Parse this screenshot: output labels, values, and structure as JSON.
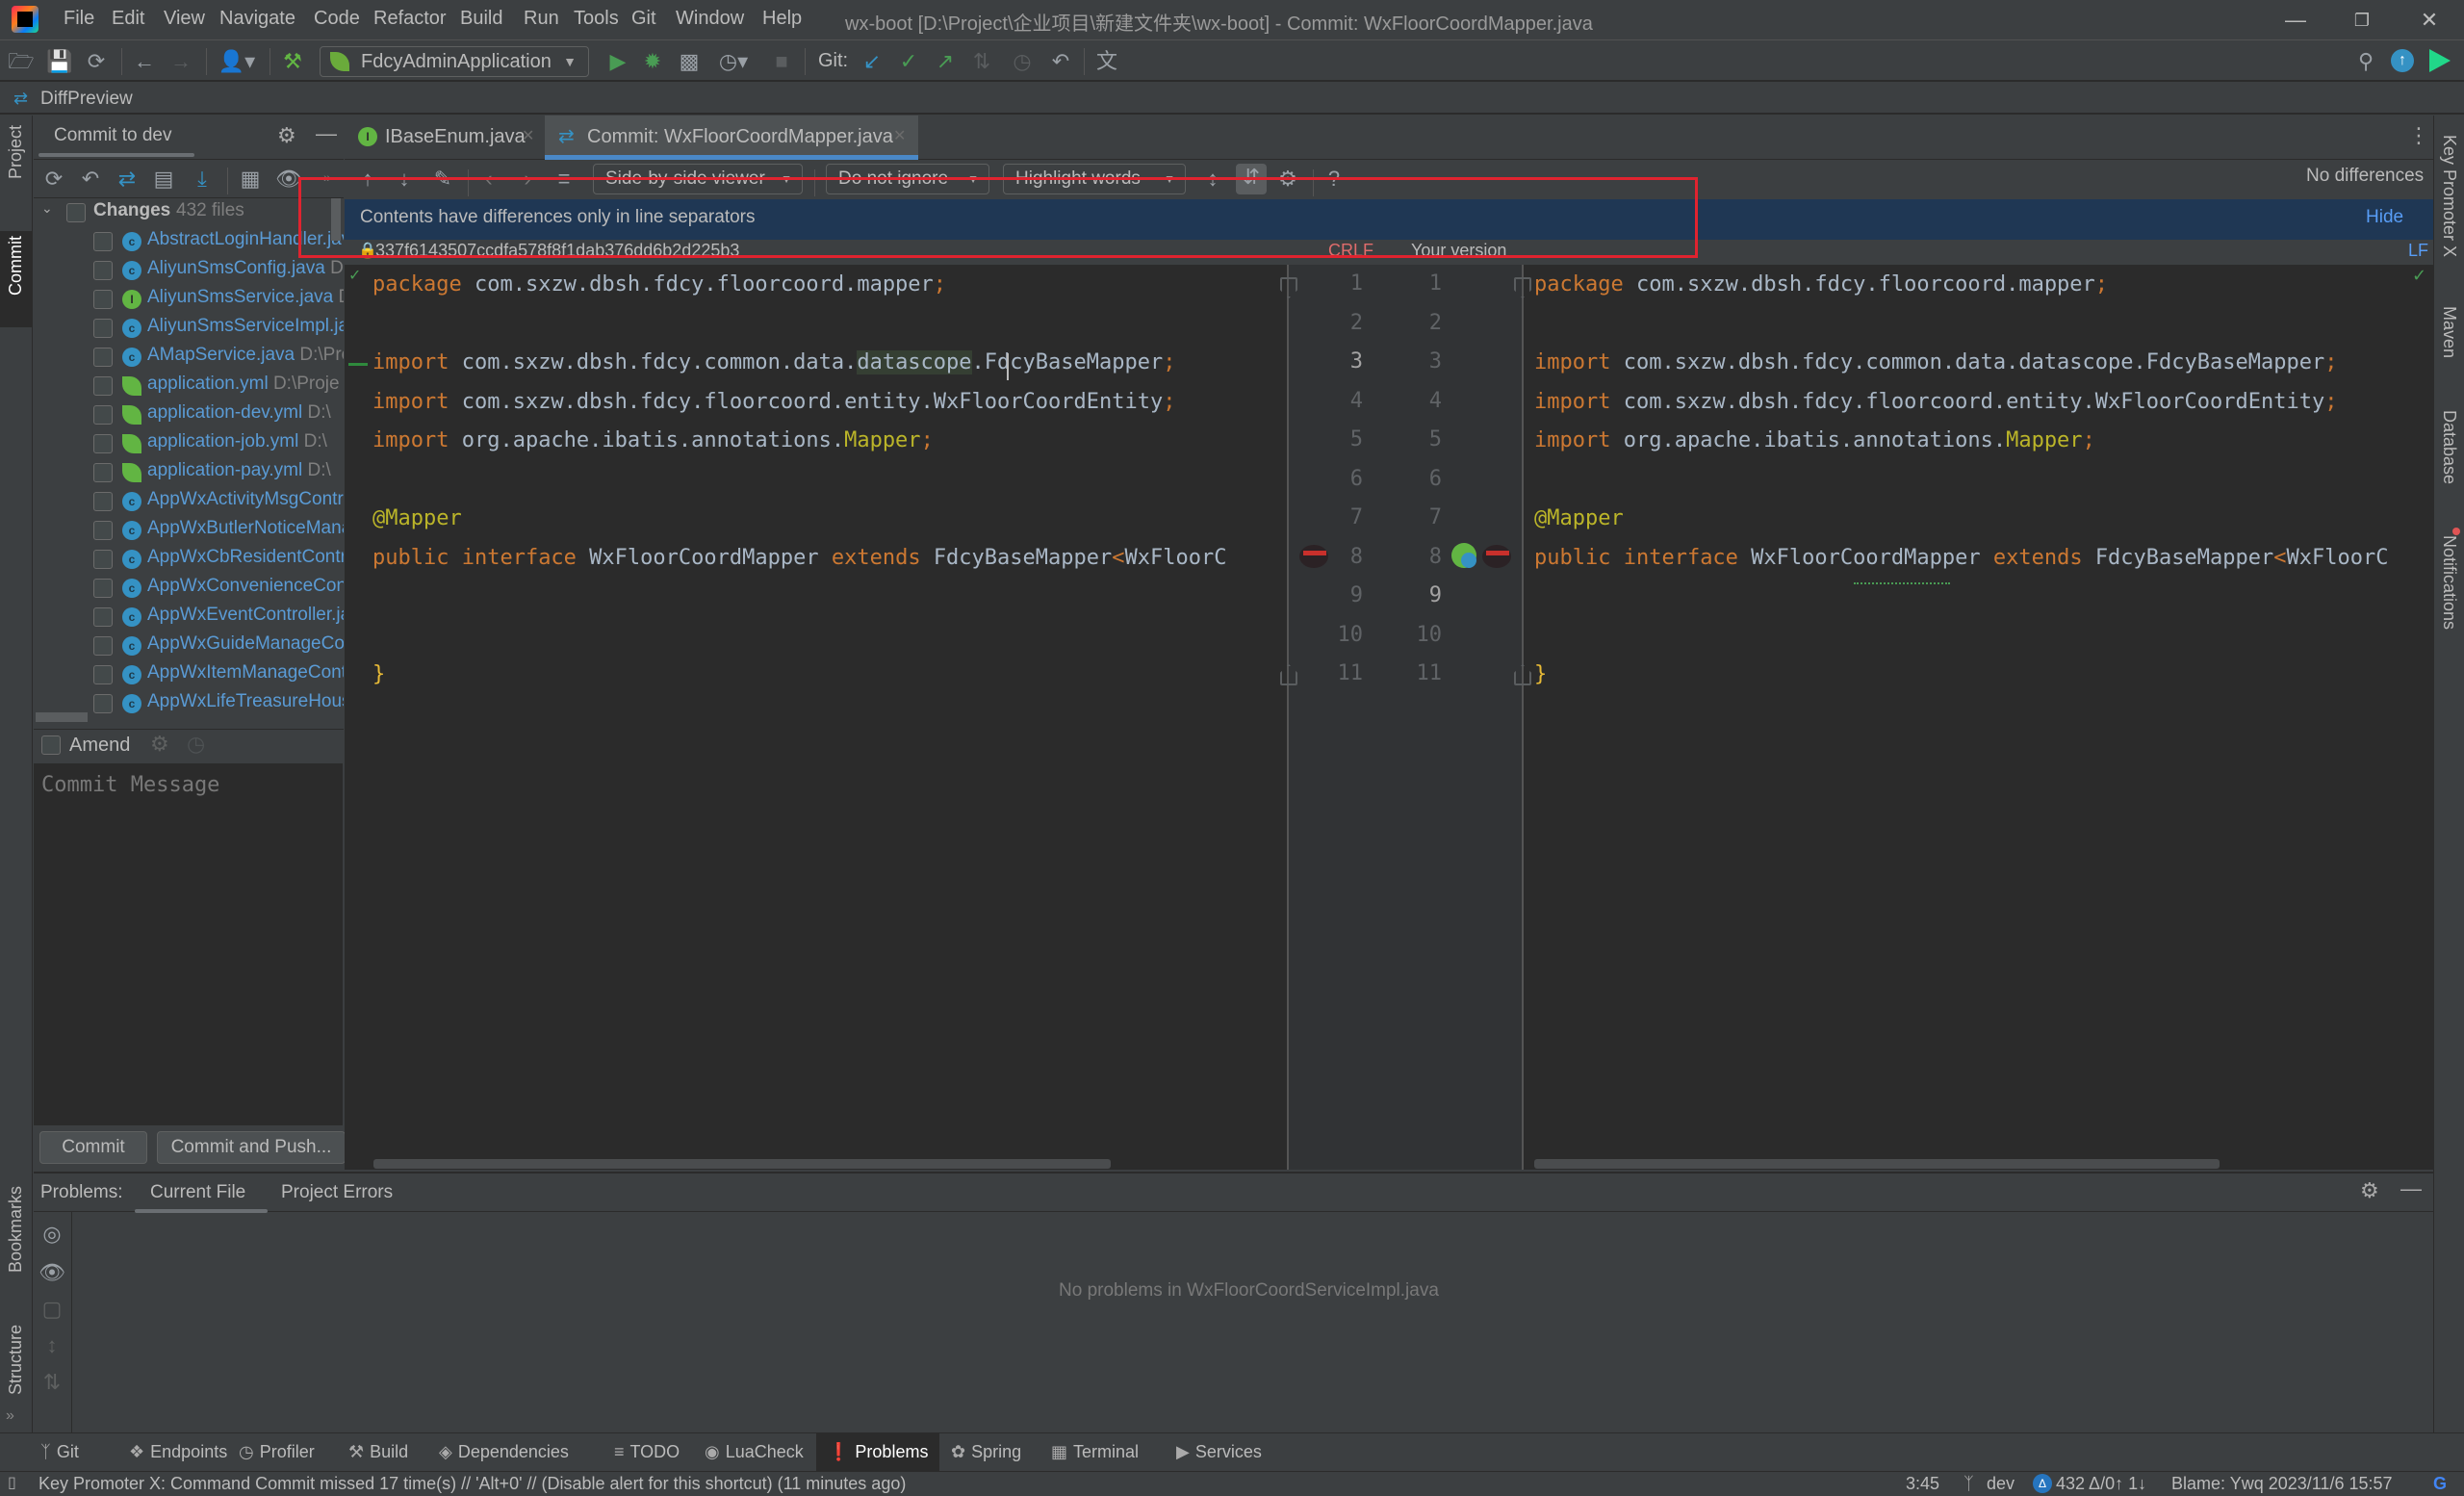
{
  "window": {
    "title": "wx-boot [D:\\Project\\企业项目\\新建文件夹\\wx-boot] - Commit: WxFloorCoordMapper.java",
    "controls": [
      "minimize",
      "restore",
      "close"
    ]
  },
  "menu": [
    "File",
    "Edit",
    "View",
    "Navigate",
    "Code",
    "Refactor",
    "Build",
    "Run",
    "Tools",
    "Git",
    "Window",
    "Help"
  ],
  "toolbar": {
    "run_config": "FdcyAdminApplication",
    "git_label": "Git:"
  },
  "diffpreview": {
    "label": "DiffPreview"
  },
  "left_stripe": {
    "project": "Project",
    "commit": "Commit",
    "bookmarks": "Bookmarks",
    "structure": "Structure"
  },
  "right_stripe": {
    "key_promoter": "Key Promoter X",
    "maven": "Maven",
    "database": "Database",
    "notifications": "Notifications"
  },
  "commit_panel": {
    "tab_label": "Commit to dev",
    "changes_label": "Changes",
    "changes_count": "432 files",
    "files": [
      {
        "name": "AbstractLoginHandler.java",
        "path": "",
        "type": "c-abstract"
      },
      {
        "name": "AliyunSmsConfig.java",
        "path": "D",
        "type": "c"
      },
      {
        "name": "AliyunSmsService.java",
        "path": "D",
        "type": "i"
      },
      {
        "name": "AliyunSmsServiceImpl.java",
        "path": "",
        "type": "c"
      },
      {
        "name": "AMapService.java",
        "path": "D:\\Pro",
        "type": "c"
      },
      {
        "name": "application.yml",
        "path": "D:\\Proje",
        "type": "yml"
      },
      {
        "name": "application-dev.yml",
        "path": "D:\\",
        "type": "yml"
      },
      {
        "name": "application-job.yml",
        "path": "D:\\",
        "type": "yml"
      },
      {
        "name": "application-pay.yml",
        "path": "D:\\",
        "type": "yml"
      },
      {
        "name": "AppWxActivityMsgController.java",
        "path": "",
        "type": "c"
      },
      {
        "name": "AppWxButlerNoticeManageController.java",
        "path": "",
        "type": "c"
      },
      {
        "name": "AppWxCbResidentController.java",
        "path": "",
        "type": "c"
      },
      {
        "name": "AppWxConvenienceController.java",
        "path": "",
        "type": "c"
      },
      {
        "name": "AppWxEventController.java",
        "path": "",
        "type": "c"
      },
      {
        "name": "AppWxGuideManageController.java",
        "path": "",
        "type": "c"
      },
      {
        "name": "AppWxItemManageController.java",
        "path": "",
        "type": "c"
      },
      {
        "name": "AppWxLifeTreasureHouseController.java",
        "path": "",
        "type": "c"
      }
    ],
    "amend_label": "Amend",
    "commit_message_placeholder": "Commit Message",
    "commit_message_value": "",
    "commit_button": "Commit",
    "commit_push_button": "Commit and Push..."
  },
  "editor_tabs": [
    {
      "label": "IBaseEnum.java",
      "icon": "interface-icon",
      "active": false
    },
    {
      "label": "Commit: WxFloorCoordMapper.java",
      "icon": "diff-icon",
      "active": true
    }
  ],
  "diff_toolbar": {
    "viewer": "Side-by-side viewer",
    "ignore": "Do not ignore",
    "highlight": "Highlight words",
    "status": "No differences"
  },
  "banner": {
    "message": "Contents have differences only in line separators",
    "hide": "Hide"
  },
  "diff_header": {
    "left_hash": "337f6143507ccdfa578f8f1dab376dd6b2d225b3",
    "left_separator": "CRLF",
    "right_title": "Your version",
    "right_separator": "LF"
  },
  "code": {
    "left_lines": [
      [
        {
          "t": "package ",
          "c": "kw"
        },
        {
          "t": "com.sxzw.dbsh.fdcy.floorcoord.mapper",
          "c": ""
        },
        {
          "t": ";",
          "c": "sym"
        }
      ],
      [],
      [
        {
          "t": "import ",
          "c": "kw"
        },
        {
          "t": "com.sxzw.dbsh.fdcy.common.data.",
          "c": ""
        },
        {
          "t": "datascope",
          "c": "hlword"
        },
        {
          "t": ".FdcyBaseMapper",
          "c": ""
        },
        {
          "t": ";",
          "c": "sym"
        }
      ],
      [
        {
          "t": "import ",
          "c": "kw"
        },
        {
          "t": "com.sxzw.dbsh.fdcy.floorcoord.entity.WxFloorCoordEntity",
          "c": ""
        },
        {
          "t": ";",
          "c": "sym"
        }
      ],
      [
        {
          "t": "import ",
          "c": "kw"
        },
        {
          "t": "org.apache.ibatis.annotations.",
          "c": ""
        },
        {
          "t": "Mapper",
          "c": "ann"
        },
        {
          "t": ";",
          "c": "sym"
        }
      ],
      [],
      [
        {
          "t": "@Mapper",
          "c": "ann"
        }
      ],
      [
        {
          "t": "public ",
          "c": "kw"
        },
        {
          "t": "interface ",
          "c": "kw"
        },
        {
          "t": "WxFloorCoordMapper ",
          "c": ""
        },
        {
          "t": "extends ",
          "c": "kw"
        },
        {
          "t": "FdcyBaseMapper",
          "c": ""
        },
        {
          "t": "<",
          "c": "sym"
        },
        {
          "t": "WxFloorC",
          "c": ""
        }
      ],
      [],
      [],
      [
        {
          "t": "}",
          "c": "brace"
        }
      ]
    ],
    "right_lines": [
      [
        {
          "t": "package ",
          "c": "kw"
        },
        {
          "t": "com.sxzw.dbsh.fdcy.floorcoord.mapper",
          "c": ""
        },
        {
          "t": ";",
          "c": "sym"
        }
      ],
      [],
      [
        {
          "t": "import ",
          "c": "kw"
        },
        {
          "t": "com.sxzw.dbsh.fdcy.common.data.datascope.FdcyBaseMapper",
          "c": ""
        },
        {
          "t": ";",
          "c": "sym"
        }
      ],
      [
        {
          "t": "import ",
          "c": "kw"
        },
        {
          "t": "com.sxzw.dbsh.fdcy.floorcoord.entity.WxFloorCoordEntity",
          "c": ""
        },
        {
          "t": ";",
          "c": "sym"
        }
      ],
      [
        {
          "t": "import ",
          "c": "kw"
        },
        {
          "t": "org.apache.ibatis.annotations.",
          "c": ""
        },
        {
          "t": "Mapper",
          "c": "ann"
        },
        {
          "t": ";",
          "c": "sym"
        }
      ],
      [],
      [
        {
          "t": "@Mapper",
          "c": "ann"
        }
      ],
      [
        {
          "t": "public ",
          "c": "kw"
        },
        {
          "t": "interface ",
          "c": "kw"
        },
        {
          "t": "WxFloorCoordMapper ",
          "c": ""
        },
        {
          "t": "extends ",
          "c": "kw"
        },
        {
          "t": "FdcyBaseMapper",
          "c": ""
        },
        {
          "t": "<",
          "c": "sym"
        },
        {
          "t": "WxFloorC",
          "c": ""
        }
      ],
      [],
      [],
      [
        {
          "t": "}",
          "c": "brace"
        }
      ]
    ],
    "line_numbers": [
      "1",
      "2",
      "3",
      "4",
      "5",
      "6",
      "7",
      "8",
      "9",
      "10",
      "11"
    ],
    "left_current_line": "3",
    "right_current_line": "9"
  },
  "problems": {
    "label": "Problems:",
    "tabs": [
      "Current File",
      "Project Errors"
    ],
    "active_tab": "Current File",
    "empty_message": "No problems in WxFloorCoordServiceImpl.java"
  },
  "tool_tabs": [
    {
      "label": "Git",
      "icon": "git-branch-icon"
    },
    {
      "label": "Endpoints",
      "icon": "endpoints-icon"
    },
    {
      "label": "Profiler",
      "icon": "profiler-icon"
    },
    {
      "label": "Build",
      "icon": "hammer-icon"
    },
    {
      "label": "Dependencies",
      "icon": "dependencies-icon"
    },
    {
      "label": "TODO",
      "icon": "list-icon"
    },
    {
      "label": "LuaCheck",
      "icon": "luacheck-icon"
    },
    {
      "label": "Problems",
      "icon": "problems-icon",
      "active": true
    },
    {
      "label": "Spring",
      "icon": "spring-icon"
    },
    {
      "label": "Terminal",
      "icon": "terminal-icon"
    },
    {
      "label": "Services",
      "icon": "services-icon"
    }
  ],
  "status_bar": {
    "message": "Key Promoter X: Command Commit missed 17 time(s) // 'Alt+0' // (Disable alert for this shortcut) (11 minutes ago)",
    "caret": "3:45",
    "branch": "dev",
    "changes": "432 Δ/0↑ 1↓",
    "blame": "Blame: Ywq 2023/11/6 15:57"
  },
  "colors": {
    "accent": "#4a88c7",
    "banner_bg": "#1f3754",
    "red_box": "#e0232f",
    "keyword": "#cc7832",
    "annotation": "#bbb529",
    "link": "#589df6",
    "crlf": "#e06c6c"
  }
}
